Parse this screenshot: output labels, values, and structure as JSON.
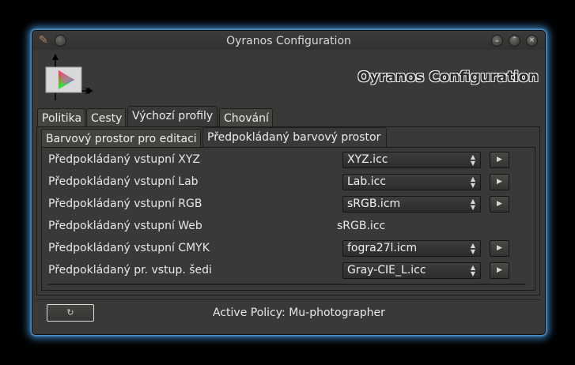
{
  "window": {
    "title": "Oyranos Configuration",
    "header_title": "Oyranos Configuration"
  },
  "tabs": [
    {
      "label": "Politika"
    },
    {
      "label": "Cesty"
    },
    {
      "label": "Výchozí profily"
    },
    {
      "label": "Chování"
    }
  ],
  "subtabs": [
    {
      "label": "Barvový prostor pro editaci"
    },
    {
      "label": "Předpokládaný barvový prostor"
    }
  ],
  "rows": [
    {
      "label": "Předpokládaný vstupní XYZ",
      "value": "XYZ.icc"
    },
    {
      "label": "Předpokládaný vstupní Lab",
      "value": "Lab.icc"
    },
    {
      "label": "Předpokládaný vstupní RGB",
      "value": "sRGB.icm"
    },
    {
      "label": "Předpokládaný vstupní Web",
      "value": "sRGB.icc"
    },
    {
      "label": "Předpokládaný vstupní CMYK",
      "value": "fogra27l.icm"
    },
    {
      "label": "Předpokládaný pr. vstup. šedi",
      "value": "Gray-CIE_L.icc"
    }
  ],
  "status": {
    "policy_label": "Active Policy:",
    "policy_value": "Mu-photographer"
  },
  "icons": {
    "app": "oyranos-app-icon",
    "logo": "color-profile-logo",
    "minimize": "chevron-down-icon",
    "maximize": "chevron-up-icon",
    "close": "close-icon",
    "combo": "updown-arrows-icon",
    "play": "play-icon",
    "reset": "reload-icon"
  },
  "colors": {
    "window_bg": "#3a3937",
    "glow": "#4696dc"
  }
}
